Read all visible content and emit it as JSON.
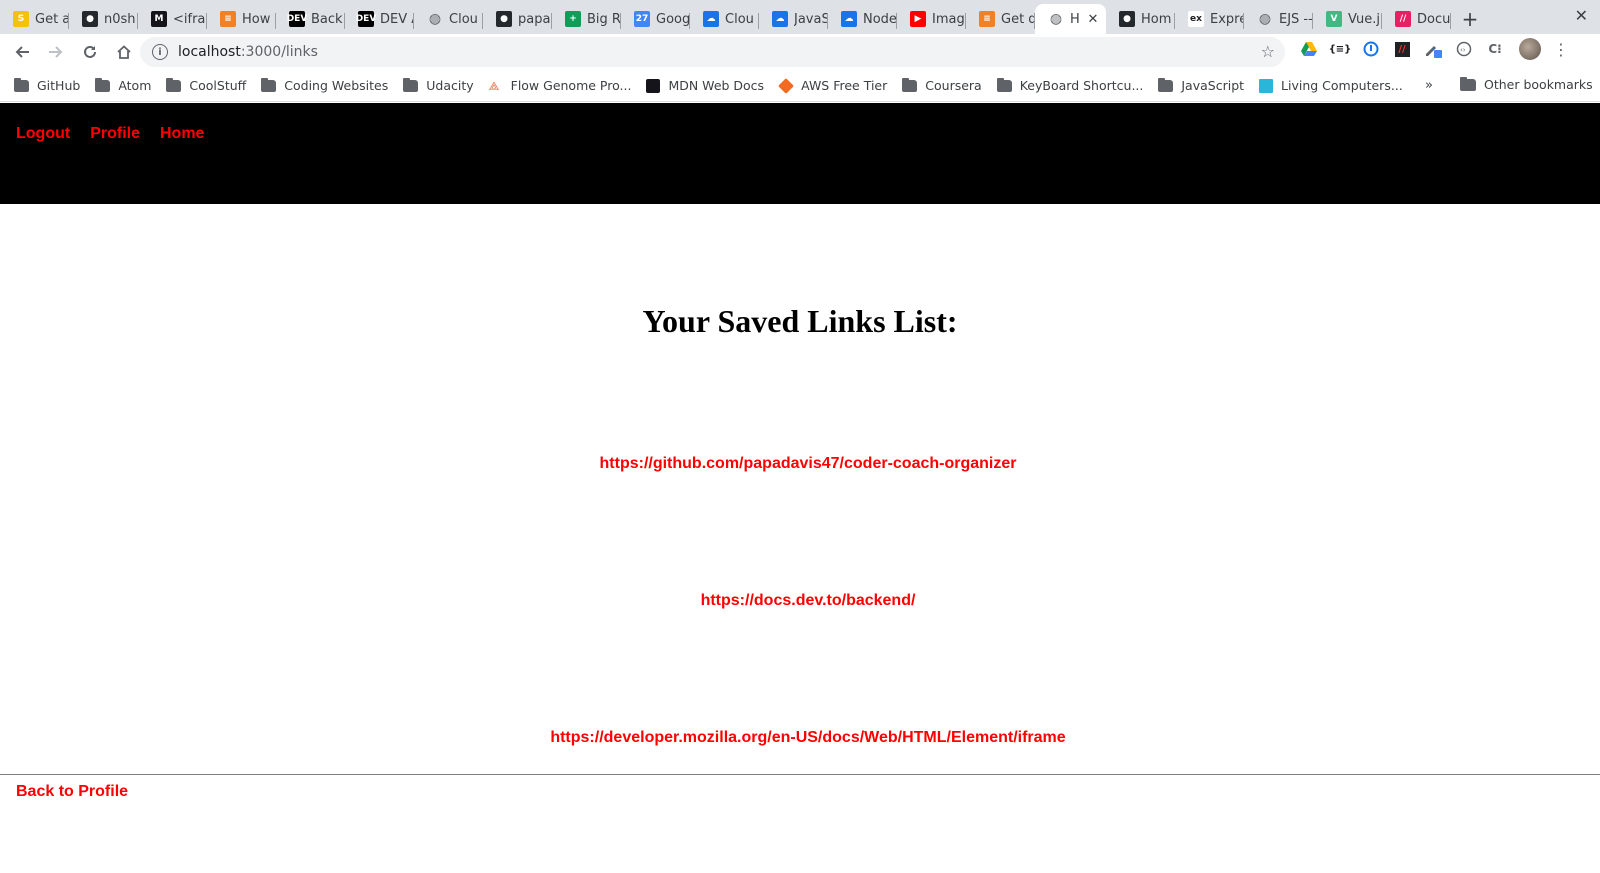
{
  "browser": {
    "tabs": [
      {
        "title": "Get a",
        "icon": "s-yellow-icon",
        "color": "#f4c20d",
        "glyph": "S"
      },
      {
        "title": "n0sh",
        "icon": "github-icon",
        "color": "#24292e",
        "glyph": "●"
      },
      {
        "title": "<ifram",
        "icon": "mdn-icon",
        "color": "#15141a",
        "glyph": "M"
      },
      {
        "title": "How",
        "icon": "stackoverflow-icon",
        "color": "#f48024",
        "glyph": "≡"
      },
      {
        "title": "Back",
        "icon": "dev-icon",
        "color": "#000000",
        "glyph": "DEV"
      },
      {
        "title": "DEV A",
        "icon": "dev-icon",
        "color": "#000000",
        "glyph": "DEV"
      },
      {
        "title": "Clou",
        "icon": "globe-icon",
        "color": "#5f6368",
        "glyph": "◍"
      },
      {
        "title": "papa",
        "icon": "github-icon",
        "color": "#24292e",
        "glyph": "●"
      },
      {
        "title": "Big R",
        "icon": "sheets-icon",
        "color": "#0f9d58",
        "glyph": "+"
      },
      {
        "title": "Goog",
        "icon": "calendar-icon",
        "color": "#4285f4",
        "glyph": "27"
      },
      {
        "title": "Clou",
        "icon": "cloud-icon",
        "color": "#1a73e8",
        "glyph": "☁"
      },
      {
        "title": "JavaS",
        "icon": "cloud-icon",
        "color": "#1a73e8",
        "glyph": "☁"
      },
      {
        "title": "Node",
        "icon": "cloud-icon",
        "color": "#1a73e8",
        "glyph": "☁"
      },
      {
        "title": "Imag",
        "icon": "youtube-icon",
        "color": "#ff0000",
        "glyph": "▶"
      },
      {
        "title": "Get d",
        "icon": "stackoverflow-icon",
        "color": "#f48024",
        "glyph": "≡"
      },
      {
        "title": "H",
        "icon": "globe-icon",
        "color": "#5f6368",
        "glyph": "◍",
        "active": true
      },
      {
        "title": "Hom",
        "icon": "github-icon",
        "color": "#24292e",
        "glyph": "●"
      },
      {
        "title": "Expre",
        "icon": "express-icon",
        "color": "#ffffff",
        "glyph": "ex"
      },
      {
        "title": "EJS --",
        "icon": "globe-icon",
        "color": "#5f6368",
        "glyph": "◍"
      },
      {
        "title": "Vue.j",
        "icon": "vue-icon",
        "color": "#42b883",
        "glyph": "V"
      },
      {
        "title": "Docu",
        "icon": "docs-icon",
        "color": "#e91e63",
        "glyph": "//"
      }
    ],
    "url": {
      "host": "localhost",
      "path": ":3000/links"
    },
    "bookmarks": [
      {
        "label": "GitHub",
        "icon": "folder-icon"
      },
      {
        "label": "Atom",
        "icon": "folder-icon"
      },
      {
        "label": "CoolStuff",
        "icon": "folder-icon"
      },
      {
        "label": "Coding Websites",
        "icon": "folder-icon"
      },
      {
        "label": "Udacity",
        "icon": "folder-icon"
      },
      {
        "label": "Flow Genome Pro...",
        "icon": "flow-genome-icon"
      },
      {
        "label": "MDN Web Docs",
        "icon": "mdn-icon"
      },
      {
        "label": "AWS Free Tier",
        "icon": "aws-icon"
      },
      {
        "label": "Coursera",
        "icon": "folder-icon"
      },
      {
        "label": "KeyBoard Shortcu...",
        "icon": "folder-icon"
      },
      {
        "label": "JavaScript",
        "icon": "folder-icon"
      },
      {
        "label": "Living Computers...",
        "icon": "living-computers-icon"
      }
    ],
    "bookmarks_overflow": "»",
    "other_bookmarks": "Other bookmarks"
  },
  "page": {
    "nav": {
      "logout": "Logout",
      "profile": "Profile",
      "home": "Home"
    },
    "heading": "Your Saved Links List:",
    "links": [
      "https://github.com/papadavis47/coder-coach-organizer",
      "https://docs.dev.to/backend/",
      "https://developer.mozilla.org/en-US/docs/Web/HTML/Element/iframe"
    ],
    "back_link": "Back to Profile",
    "colors": {
      "nav_bg": "#000000",
      "link": "#ff0000"
    }
  }
}
